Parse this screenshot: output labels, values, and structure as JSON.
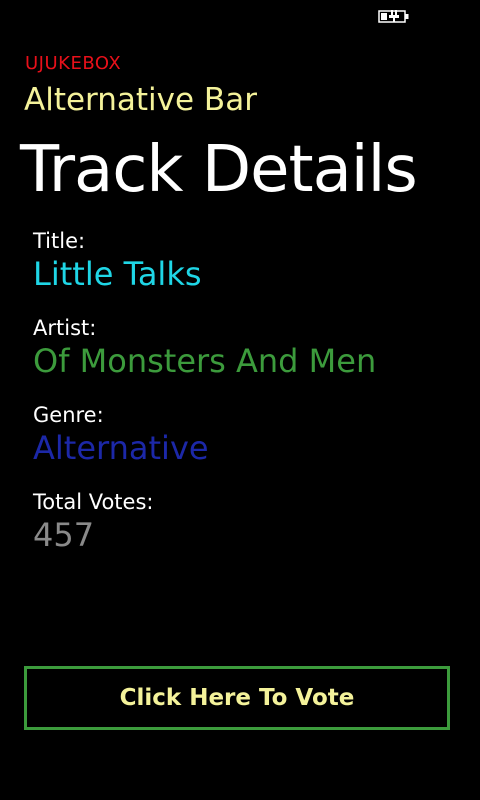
{
  "app": {
    "name": "UJUKEBOX",
    "venue": "Alternative Bar",
    "page_title": "Track Details"
  },
  "status_bar": {
    "battery_icon": "battery-charging-icon"
  },
  "track": {
    "title_label": "Title:",
    "title": "Little Talks",
    "artist_label": "Artist:",
    "artist": "Of Monsters And Men",
    "genre_label": "Genre:",
    "genre": "Alternative",
    "votes_label": "Total Votes:",
    "votes": "457"
  },
  "actions": {
    "vote_label": "Click Here To Vote"
  },
  "colors": {
    "background": "#000000",
    "app_name": "#e8101a",
    "venue": "#f4f29a",
    "title_value": "#1fd6e6",
    "artist_value": "#3c9b3c",
    "genre_value": "#1c28a8",
    "votes_value": "#8a8a8a",
    "button_border": "#3c9b3c",
    "button_text": "#f4f29a"
  }
}
